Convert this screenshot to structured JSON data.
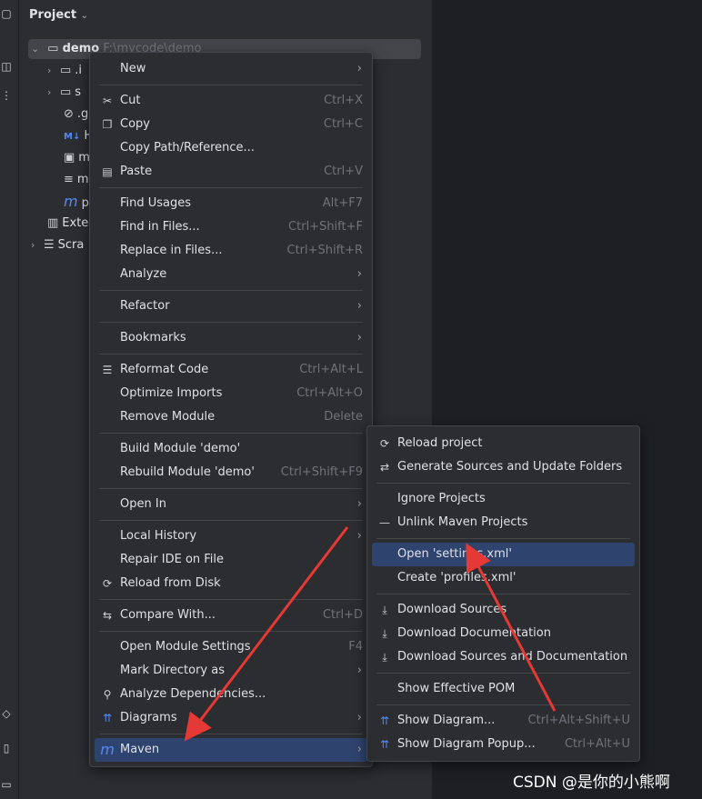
{
  "panel": {
    "title": "Project"
  },
  "tree": {
    "root_name": "demo",
    "root_path": "F:\\mycode\\demo",
    "rows": [
      {
        "label": ".i",
        "icon": "folder-icon"
      },
      {
        "label": "s",
        "icon": "folder-icon"
      },
      {
        "label": ".g",
        "icon": "ignored-file-icon"
      },
      {
        "label": "H",
        "icon": "markdown-icon"
      },
      {
        "label": "m",
        "icon": "terminal-file-icon"
      },
      {
        "label": "m",
        "icon": "text-file-icon"
      },
      {
        "label": "p",
        "icon": "maven-icon"
      },
      {
        "label": "Exte",
        "icon": "libraries-icon"
      },
      {
        "label": "Scra",
        "icon": "scratches-icon"
      }
    ]
  },
  "context_menu": {
    "items": [
      {
        "label": "New",
        "shortcut": "",
        "submenu": true
      },
      {
        "label": "Cut",
        "shortcut": "Ctrl+X",
        "icon": "scissors-icon"
      },
      {
        "label": "Copy",
        "shortcut": "Ctrl+C",
        "icon": "copy-icon"
      },
      {
        "label": "Copy Path/Reference...",
        "shortcut": ""
      },
      {
        "label": "Paste",
        "shortcut": "Ctrl+V",
        "icon": "paste-icon"
      },
      {
        "label": "Find Usages",
        "shortcut": "Alt+F7"
      },
      {
        "label": "Find in Files...",
        "shortcut": "Ctrl+Shift+F"
      },
      {
        "label": "Replace in Files...",
        "shortcut": "Ctrl+Shift+R"
      },
      {
        "label": "Analyze",
        "shortcut": "",
        "submenu": true
      },
      {
        "label": "Refactor",
        "shortcut": "",
        "submenu": true
      },
      {
        "label": "Bookmarks",
        "shortcut": "",
        "submenu": true
      },
      {
        "label": "Reformat Code",
        "shortcut": "Ctrl+Alt+L",
        "icon": "reformat-icon"
      },
      {
        "label": "Optimize Imports",
        "shortcut": "Ctrl+Alt+O"
      },
      {
        "label": "Remove Module",
        "shortcut": "Delete"
      },
      {
        "label": "Build Module 'demo'",
        "shortcut": ""
      },
      {
        "label": "Rebuild Module 'demo'",
        "shortcut": "Ctrl+Shift+F9"
      },
      {
        "label": "Open In",
        "shortcut": "",
        "submenu": true
      },
      {
        "label": "Local History",
        "shortcut": "",
        "submenu": true
      },
      {
        "label": "Repair IDE on File",
        "shortcut": ""
      },
      {
        "label": "Reload from Disk",
        "shortcut": "",
        "icon": "reload-icon"
      },
      {
        "label": "Compare With...",
        "shortcut": "Ctrl+D",
        "icon": "compare-icon"
      },
      {
        "label": "Open Module Settings",
        "shortcut": "F4"
      },
      {
        "label": "Mark Directory as",
        "shortcut": "",
        "submenu": true
      },
      {
        "label": "Analyze Dependencies...",
        "shortcut": "",
        "icon": "analyze-deps-icon"
      },
      {
        "label": "Diagrams",
        "shortcut": "",
        "submenu": true,
        "icon": "diagram-icon"
      },
      {
        "label": "Maven",
        "shortcut": "",
        "submenu": true,
        "icon": "maven-icon",
        "selected": true
      }
    ]
  },
  "maven_menu": {
    "items": [
      {
        "label": "Reload project",
        "shortcut": "",
        "icon": "reload-icon"
      },
      {
        "label": "Generate Sources and Update Folders",
        "shortcut": "",
        "icon": "generate-icon"
      },
      {
        "label": "Ignore Projects",
        "shortcut": ""
      },
      {
        "label": "Unlink Maven Projects",
        "shortcut": "",
        "icon": "minus-icon"
      },
      {
        "label": "Open 'settings.xml'",
        "shortcut": "",
        "selected": true
      },
      {
        "label": "Create 'profiles.xml'",
        "shortcut": ""
      },
      {
        "label": "Download Sources",
        "shortcut": "",
        "icon": "download-icon"
      },
      {
        "label": "Download Documentation",
        "shortcut": "",
        "icon": "download-icon"
      },
      {
        "label": "Download Sources and Documentation",
        "shortcut": "",
        "icon": "download-icon"
      },
      {
        "label": "Show Effective POM",
        "shortcut": ""
      },
      {
        "label": "Show Diagram...",
        "shortcut": "Ctrl+Alt+Shift+U",
        "icon": "diagram-icon"
      },
      {
        "label": "Show Diagram Popup...",
        "shortcut": "Ctrl+Alt+U",
        "icon": "diagram-icon"
      }
    ]
  },
  "watermark": "CSDN @是你的小熊啊",
  "colors": {
    "selection": "#2e436e",
    "annotation_arrow": "#e53935",
    "maven_icon": "#548af7"
  }
}
